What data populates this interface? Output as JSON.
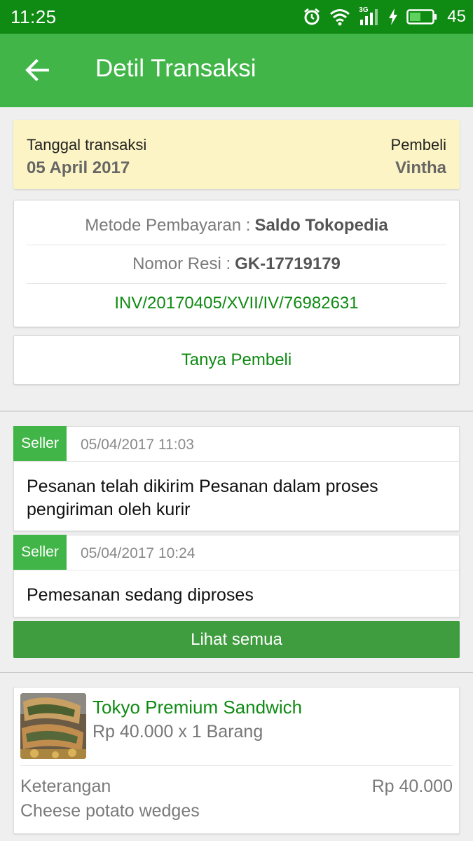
{
  "status_bar": {
    "time": "11:25",
    "network": "3G",
    "battery": "45"
  },
  "app_bar": {
    "title": "Detil Transaksi"
  },
  "transaction": {
    "date_label": "Tanggal transaksi",
    "date_value": "05 April 2017",
    "buyer_label": "Pembeli",
    "buyer_value": "Vintha"
  },
  "details": {
    "payment_label": "Metode Pembayaran :",
    "payment_value": "Saldo Tokopedia",
    "receipt_label": "Nomor Resi :",
    "receipt_value": "GK-17719179",
    "invoice": "INV/20170405/XVII/IV/76982631"
  },
  "ask_buyer_label": "Tanya Pembeli",
  "history": [
    {
      "actor": "Seller",
      "timestamp": "05/04/2017 11:03",
      "message": "Pesanan telah dikirim Pesanan dalam proses pengiriman oleh kurir"
    },
    {
      "actor": "Seller",
      "timestamp": "05/04/2017 10:24",
      "message": "Pemesanan sedang diproses"
    }
  ],
  "see_all_label": "Lihat semua",
  "product": {
    "name": "Tokyo Premium Sandwich",
    "price_qty": "Rp 40.000 x 1 Barang",
    "note_label": "Keterangan",
    "note_value": "Cheese potato wedges",
    "subtotal": "Rp 40.000"
  },
  "colors": {
    "status_bar": "#0f8a13",
    "app_bar": "#42b549",
    "accent_text": "#0f8a13",
    "button": "#3f9c3f",
    "date_card_bg": "#fcf4c4"
  }
}
